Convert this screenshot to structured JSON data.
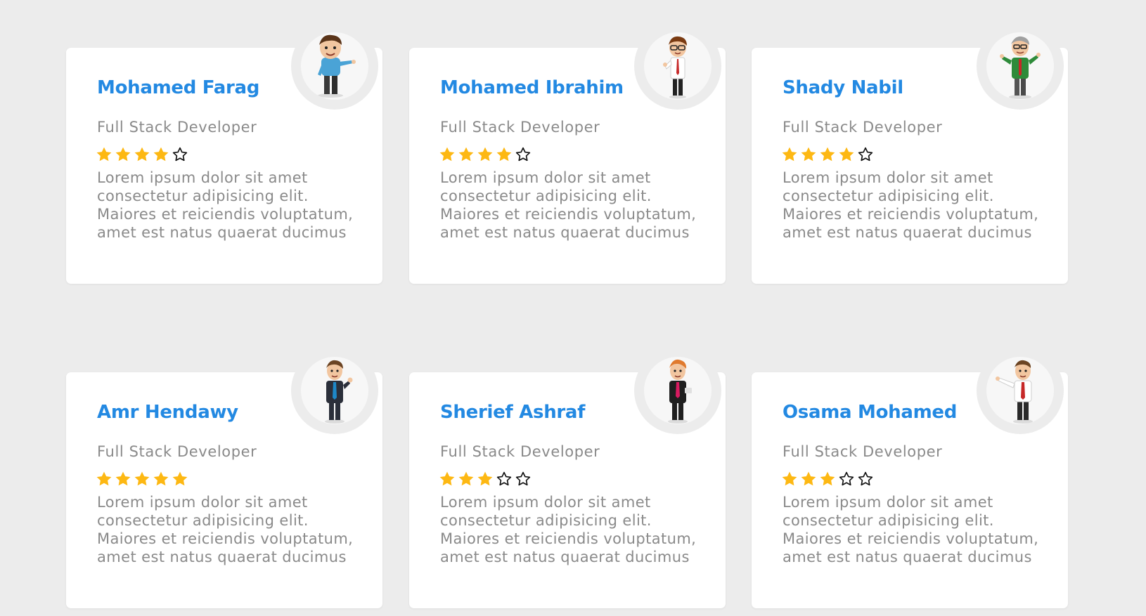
{
  "colors": {
    "background": "#ececec",
    "card": "#ffffff",
    "name": "#2389e2",
    "text": "#8a8a8a",
    "star_filled": "#fdb813",
    "star_empty_outline": "#111111"
  },
  "cards": [
    {
      "name": "Mohamed Farag",
      "role": "Full Stack Developer",
      "rating": 4,
      "rating_max": 5,
      "avatar_icon": "cartoon-man-blue-shirt-icon",
      "description": [
        "Lorem ipsum dolor sit amet",
        "consectetur adipisicing elit.",
        "Maiores et reiciendis voluptatum,",
        "amet est natus quaerat ducimus"
      ]
    },
    {
      "name": "Mohamed Ibrahim",
      "role": "Full Stack Developer",
      "rating": 4,
      "rating_max": 5,
      "avatar_icon": "cartoon-man-glasses-tie-icon",
      "description": [
        "Lorem ipsum dolor sit amet",
        "consectetur adipisicing elit.",
        "Maiores et reiciendis voluptatum,",
        "amet est natus quaerat ducimus"
      ]
    },
    {
      "name": "Shady Nabil",
      "role": "Full Stack Developer",
      "rating": 4,
      "rating_max": 5,
      "avatar_icon": "cartoon-man-green-jacket-icon",
      "description": [
        "Lorem ipsum dolor sit amet",
        "consectetur adipisicing elit.",
        "Maiores et reiciendis voluptatum,",
        "amet est natus quaerat ducimus"
      ]
    },
    {
      "name": "Amr Hendawy",
      "role": "Full Stack Developer",
      "rating": 5,
      "rating_max": 5,
      "avatar_icon": "cartoon-man-suit-thumbs-up-icon",
      "description": [
        "Lorem ipsum dolor sit amet",
        "consectetur adipisicing elit.",
        "Maiores et reiciendis voluptatum,",
        "amet est natus quaerat ducimus"
      ]
    },
    {
      "name": "Sherief Ashraf",
      "role": "Full Stack Developer",
      "rating": 3,
      "rating_max": 5,
      "avatar_icon": "cartoon-man-redhead-suit-icon",
      "description": [
        "Lorem ipsum dolor sit amet",
        "consectetur adipisicing elit.",
        "Maiores et reiciendis voluptatum,",
        "amet est natus quaerat ducimus"
      ]
    },
    {
      "name": "Osama Mohamed",
      "role": "Full Stack Developer",
      "rating": 3,
      "rating_max": 5,
      "avatar_icon": "cartoon-man-presenting-icon",
      "description": [
        "Lorem ipsum dolor sit amet",
        "consectetur adipisicing elit.",
        "Maiores et reiciendis voluptatum,",
        "amet est natus quaerat ducimus"
      ]
    }
  ]
}
